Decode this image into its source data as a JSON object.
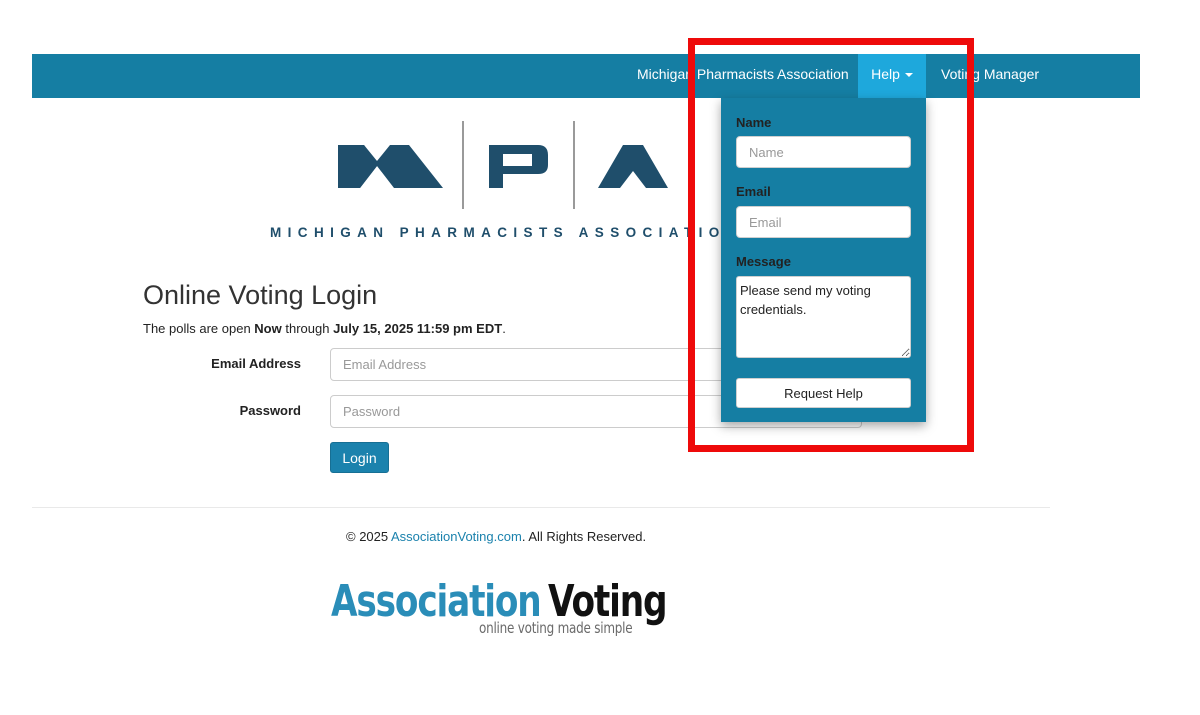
{
  "navbar": {
    "org_name": "Michigan Pharmacists Association",
    "help_label": "Help",
    "manager_label": "Voting Manager",
    "color": "#157ea3",
    "active_color": "#1ea8dc"
  },
  "help_dropdown": {
    "name_label": "Name",
    "name_placeholder": "Name",
    "email_label": "Email",
    "email_placeholder": "Email",
    "message_label": "Message",
    "message_value": "Please send my voting credentials.",
    "submit_label": "Request Help"
  },
  "logo": {
    "letters": [
      "M",
      "P",
      "A"
    ],
    "subtitle": "MICHIGAN PHARMACISTS ASSOCIATION",
    "color": "#1f4e6b"
  },
  "login": {
    "title": "Online Voting Login",
    "polls_prefix": "The polls are open ",
    "polls_now": "Now",
    "polls_through": " through ",
    "polls_deadline": "July 15, 2025 11:59 pm EDT",
    "polls_suffix": ".",
    "email_label": "Email Address",
    "email_placeholder": "Email Address",
    "password_label": "Password",
    "password_placeholder": "Password",
    "login_label": "Login"
  },
  "footer": {
    "copyright_prefix": "© 2025 ",
    "link_text": "AssociationVoting.com",
    "copyright_suffix": ". All Rights Reserved."
  },
  "brand": {
    "part1": "Association",
    "part2": "Voting",
    "tagline": "online voting made simple",
    "color1": "#2a8db8",
    "color2": "#111111"
  },
  "highlight_color": "#ee0a0a"
}
